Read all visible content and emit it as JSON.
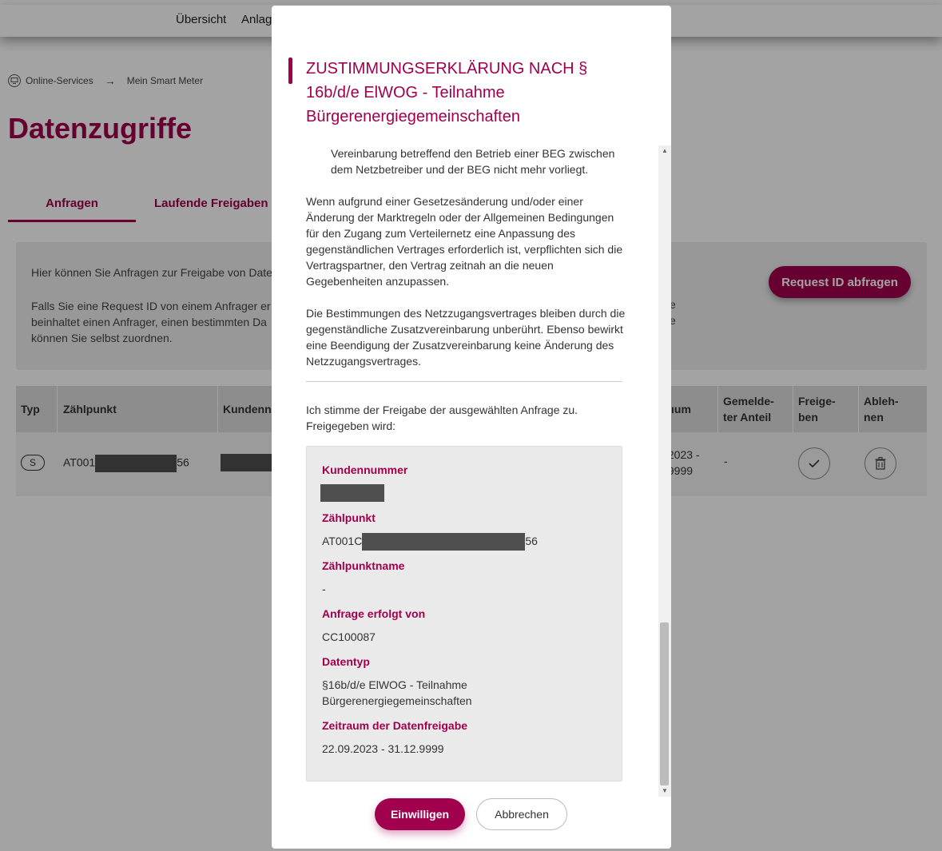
{
  "nav": {
    "items": [
      "Übersicht",
      "Anlag"
    ]
  },
  "breadcrumb": {
    "items": [
      "Online-Services",
      "Mein Smart Meter"
    ]
  },
  "page": {
    "title": "Datenzugriffe"
  },
  "tabs": [
    "Anfragen",
    "Laufende Freigaben"
  ],
  "info": {
    "line1": "Hier können Sie Anfragen zur Freigabe von Date",
    "line2": "Falls Sie eine Request ID von einem Anfrager er",
    "line3": "beinhaltet einen Anfrager, einen bestimmten Da",
    "line4": "können Sie selbst zuordnen.",
    "stray1": "e",
    "stray2": "e"
  },
  "request_button": "Request ID abfragen",
  "table": {
    "headers": [
      "Typ",
      "Zählpunkt",
      "Kundennu",
      "ıum",
      "Gemelde-\nter Anteil",
      "Freige-\nben",
      "Ableh-\nnen"
    ],
    "row": {
      "type": "S",
      "zaehlpunkt_prefix": "AT001",
      "zaehlpunkt_suffix": "56",
      "zeitraum_line1": ".2023 -",
      "zeitraum_line2": ".9999",
      "anteil": "-"
    }
  },
  "modal": {
    "title": "ZUSTIMMUNGSERKLÄRUNG NACH § 16b/d/e ElWOG - Teilnahme Bürgerenergiegemeinschaften",
    "para0": "Vereinbarung betreffend den Betrieb einer BEG zwischen dem Netzbetreiber und der BEG nicht mehr vorliegt.",
    "para1": "Wenn aufgrund einer Gesetzesänderung und/oder einer Änderung der Marktregeln oder der Allgemeinen Bedingungen für den Zugang zum Verteilernetz eine Anpassung des gegenständlichen Vertrages erforderlich ist, verpflichten sich die Vertragspartner, den Vertrag zeitnah an die neuen Gegebenheiten anzupassen.",
    "para2": "Die Bestimmungen des Netzzugangsvertrages bleiben durch die gegenständliche Zusatzvereinbarung unberührt. Ebenso bewirkt eine Beendigung der Zusatzvereinbarung keine Änderung des Netzzugangsvertrages.",
    "consent": "Ich stimme der Freigabe der ausgewählten Anfrage zu. Freigegeben wird:",
    "summary": {
      "kundennummer_label": "Kundennummer",
      "zaehlpunkt_label": "Zählpunkt",
      "zaehlpunkt_prefix": "AT001C",
      "zaehlpunkt_suffix": "56",
      "zaehlpunktname_label": "Zählpunktname",
      "zaehlpunktname_value": "-",
      "anfrage_label": "Anfrage erfolgt von",
      "anfrage_value": "CC100087",
      "datentyp_label": "Datentyp",
      "datentyp_value": "§16b/d/e ElWOG - Teilnahme Bürgerenergiegemeinschaften",
      "zeitraum_label": "Zeitraum der Datenfreigabe",
      "zeitraum_value": "22.09.2023 - 31.12.9999"
    },
    "confirm_button": "Einwilligen",
    "cancel_button": "Abbrechen"
  },
  "colors": {
    "accent": "#a0004e",
    "redaction": "#4f4f4f"
  }
}
